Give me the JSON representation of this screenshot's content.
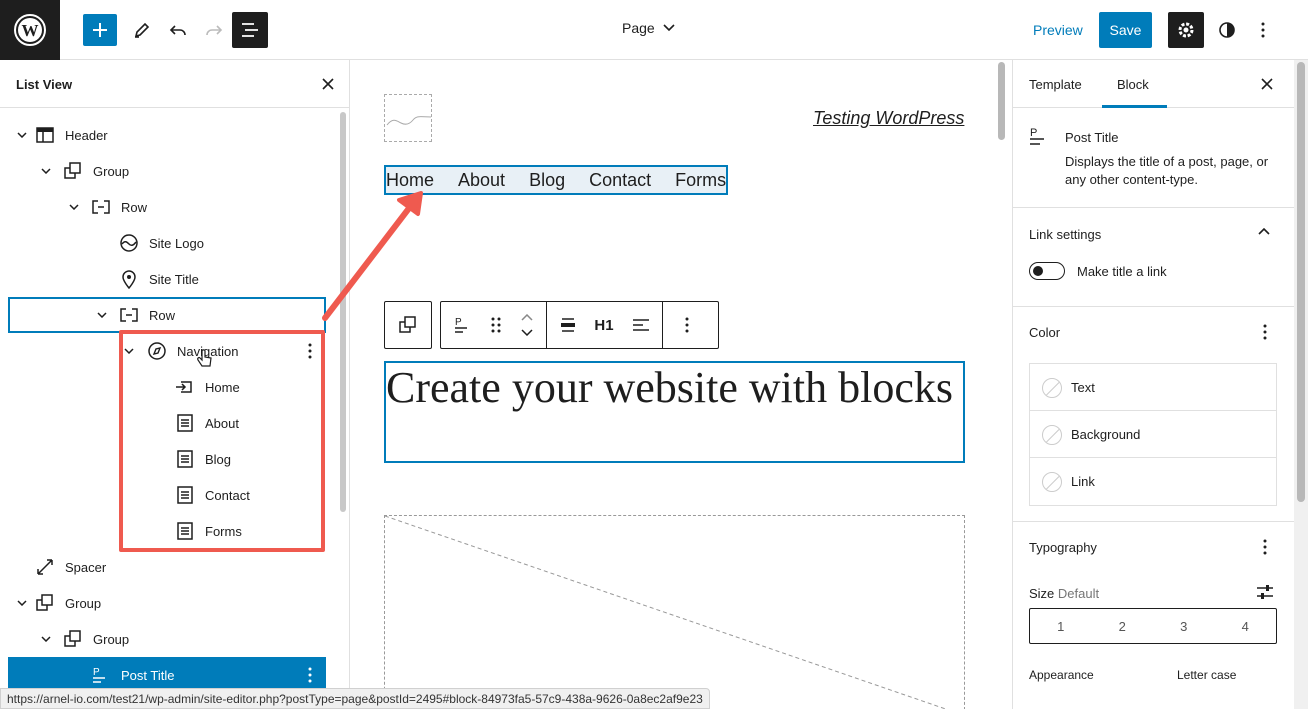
{
  "topbar": {
    "document_title": "Page",
    "preview_label": "Preview",
    "save_label": "Save"
  },
  "listview": {
    "title": "List View",
    "items": [
      {
        "label": "Header",
        "icon": "template-part-icon"
      },
      {
        "label": "Group",
        "icon": "group-icon"
      },
      {
        "label": "Row",
        "icon": "row-icon"
      },
      {
        "label": "Site Logo",
        "icon": "site-logo-icon"
      },
      {
        "label": "Site Title",
        "icon": "map-pin-icon"
      },
      {
        "label": "Row",
        "icon": "row-icon"
      },
      {
        "label": "Navigation",
        "icon": "compass-icon"
      },
      {
        "label": "Home",
        "icon": "home-link-icon"
      },
      {
        "label": "About",
        "icon": "page-icon"
      },
      {
        "label": "Blog",
        "icon": "page-icon"
      },
      {
        "label": "Contact",
        "icon": "page-icon"
      },
      {
        "label": "Forms",
        "icon": "page-icon"
      },
      {
        "label": "Spacer",
        "icon": "spacer-icon"
      },
      {
        "label": "Group",
        "icon": "group-icon"
      },
      {
        "label": "Group",
        "icon": "group-icon"
      },
      {
        "label": "Post Title",
        "icon": "post-title-icon"
      }
    ]
  },
  "canvas": {
    "site_title": "Testing WordPress",
    "nav_items": [
      "Home",
      "About",
      "Blog",
      "Contact",
      "Forms"
    ],
    "post_title": "Create your website with blocks",
    "toolbar_heading_level": "H1"
  },
  "settings": {
    "tabs": [
      "Template",
      "Block"
    ],
    "active_tab": "Block",
    "block_card": {
      "title": "Post Title",
      "description": "Displays the title of a post, page, or any other content-type."
    },
    "link_settings": {
      "title": "Link settings",
      "toggle_label": "Make title a link"
    },
    "color": {
      "title": "Color",
      "items": [
        "Text",
        "Background",
        "Link"
      ]
    },
    "typography": {
      "title": "Typography",
      "size_label": "Size",
      "size_value": "Default",
      "sizes": [
        "1",
        "2",
        "3",
        "4"
      ],
      "appearance_label": "Appearance",
      "letter_case_label": "Letter case"
    }
  },
  "statusbar": {
    "url": "https://arnel-io.com/test21/wp-admin/site-editor.php?postType=page&postId=2495#block-84973fa5-57c9-438a-9626-0a8ec2af9e23"
  },
  "colors": {
    "accent": "#007cba",
    "annotation": "#ef5a4f",
    "dark": "#1e1e1e"
  }
}
